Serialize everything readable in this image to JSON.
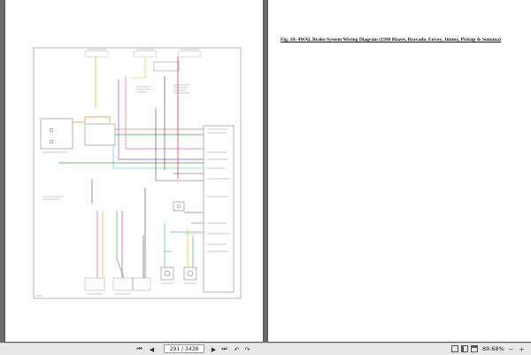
{
  "document": {
    "right_page_title": "Fig. 10: 4WAL Brake System Wiring Diagram (1990 Blazer, Bravado, Envoy, Jimmy, Pickup & Sonoma)"
  },
  "toolbar": {
    "page_indicator": "291 / 3438",
    "zoom_level": "89.68%",
    "icons": [
      "first-page-icon",
      "prev-page-icon",
      "next-page-icon",
      "last-page-icon",
      "back-icon",
      "forward-icon",
      "single-page-icon",
      "two-page-icon",
      "scroll-icon",
      "zoom-out-icon",
      "zoom-in-icon"
    ]
  },
  "colors": {
    "wire_red": "#d04040",
    "wire_pink": "#e070c0",
    "wire_cyan": "#40c0d0",
    "wire_green": "#40a040",
    "wire_yellow": "#d8c030",
    "wire_orange": "#e09030",
    "wire_purple": "#a050c0",
    "wire_black": "#222222"
  }
}
